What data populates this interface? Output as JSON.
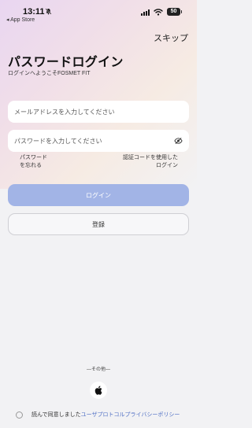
{
  "status_bar": {
    "time": "13:11",
    "back_label": "◂ App Store",
    "battery": "50"
  },
  "header": {
    "skip_label": "スキップ",
    "title": "パスワードログイン",
    "subtitle": "ログインへようこそFOSMET FIT"
  },
  "form": {
    "email_placeholder": "メールアドレスを入力してください",
    "password_placeholder": "パスワードを入力してください",
    "forgot_label": "パスワードを忘れる",
    "code_login_label": "認証コードを使用したログイン"
  },
  "buttons": {
    "login_label": "ログイン",
    "register_label": "登録"
  },
  "other": {
    "label": "—その他—"
  },
  "agreement": {
    "prefix": "読んで同意しました",
    "user_protocol": "ユーザプロトコル",
    "privacy_policy": "プライバシーポリシー"
  },
  "colors": {
    "login_button": "#a2b4e6",
    "link": "#4f6fc4"
  },
  "icons": [
    "bell-slash-icon",
    "signal-icon",
    "wifi-icon",
    "battery-icon",
    "eye-off-icon",
    "apple-icon"
  ]
}
